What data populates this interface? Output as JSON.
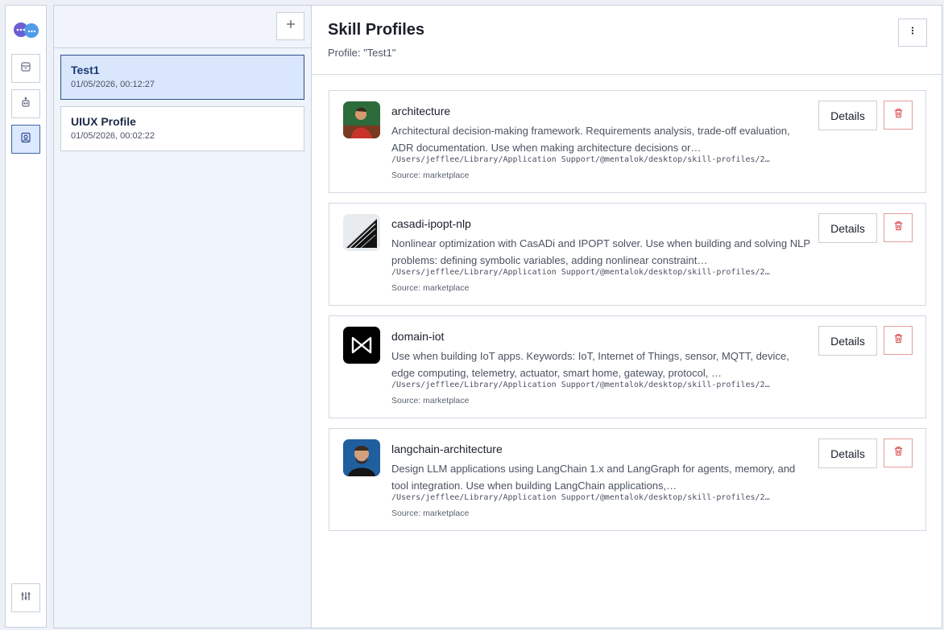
{
  "rail": {
    "items": [
      {
        "icon": "archive-icon"
      },
      {
        "icon": "robot-icon"
      },
      {
        "icon": "profile-icon",
        "active": true
      }
    ],
    "bottom_icon": "sliders-icon"
  },
  "profiles": {
    "add_icon": "plus-icon",
    "items": [
      {
        "name": "Test1",
        "date": "01/05/2026, 00:12:27",
        "selected": true
      },
      {
        "name": "UIUX Profile",
        "date": "01/05/2026, 00:02:22",
        "selected": false
      }
    ]
  },
  "main": {
    "title": "Skill Profiles",
    "subtitle": "Profile: \"Test1\"",
    "menu_icon": "kebab-icon"
  },
  "skills": [
    {
      "name": "architecture",
      "description": "Architectural decision-making framework. Requirements analysis, trade-off evaluation, ADR documentation. Use when making architecture decisions or…",
      "path": "/Users/jefflee/Library/Application Support/@mentalok/desktop/skill-profiles/2…",
      "source": "Source: marketplace",
      "details_label": "Details"
    },
    {
      "name": "casadi-ipopt-nlp",
      "description": "Nonlinear optimization with CasADi and IPOPT solver. Use when building and solving NLP problems: defining symbolic variables, adding nonlinear constraint…",
      "path": "/Users/jefflee/Library/Application Support/@mentalok/desktop/skill-profiles/2…",
      "source": "Source: marketplace",
      "details_label": "Details"
    },
    {
      "name": "domain-iot",
      "description": "Use when building IoT apps. Keywords: IoT, Internet of Things, sensor, MQTT, device, edge computing, telemetry, actuator, smart home, gateway, protocol, …",
      "path": "/Users/jefflee/Library/Application Support/@mentalok/desktop/skill-profiles/2…",
      "source": "Source: marketplace",
      "details_label": "Details"
    },
    {
      "name": "langchain-architecture",
      "description": "Design LLM applications using LangChain 1.x and LangGraph for agents, memory, and tool integration. Use when building LangChain applications,…",
      "path": "/Users/jefflee/Library/Application Support/@mentalok/desktop/skill-profiles/2…",
      "source": "Source: marketplace",
      "details_label": "Details"
    }
  ],
  "colors": {
    "accent": "#3f62a8",
    "selected_bg": "#d9e6fc",
    "danger": "#d84a4a",
    "logo_purple": "#6b5fd3",
    "logo_blue": "#4f9be8"
  }
}
